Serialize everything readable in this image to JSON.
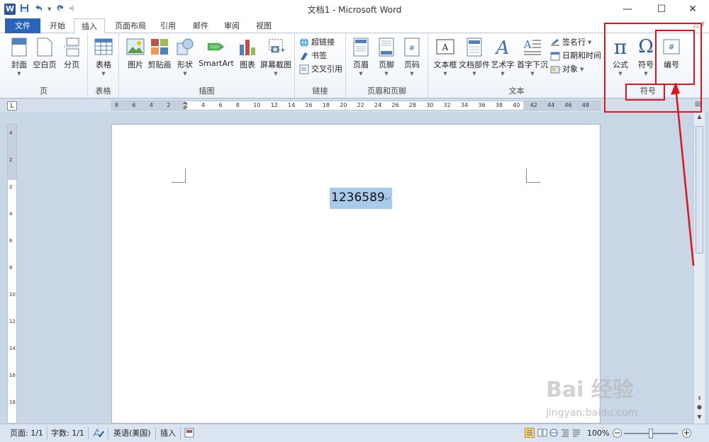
{
  "titlebar": {
    "app_icon_letter": "W",
    "title": "文档1 - Microsoft Word",
    "minimize": "—",
    "maximize": "☐",
    "close": "✕"
  },
  "tabs": {
    "file": "文件",
    "items": [
      "开始",
      "插入",
      "页面布局",
      "引用",
      "邮件",
      "审阅",
      "视图"
    ],
    "active": "插入"
  },
  "ribbon": {
    "page_group": {
      "label": "页",
      "buttons": [
        "封面",
        "空白页",
        "分页"
      ]
    },
    "table_group": {
      "label": "表格",
      "buttons": [
        "表格"
      ]
    },
    "illustrations_group": {
      "label": "插图",
      "buttons": [
        "图片",
        "剪贴画",
        "形状",
        "SmartArt",
        "图表",
        "屏幕截图"
      ]
    },
    "links_group": {
      "label": "链接",
      "buttons": [
        "超链接",
        "书签",
        "交叉引用"
      ]
    },
    "header_footer_group": {
      "label": "页眉和页脚",
      "buttons": [
        "页眉",
        "页脚",
        "页码"
      ]
    },
    "text_group": {
      "label": "文本",
      "buttons": [
        "文本框",
        "文档部件",
        "艺术字",
        "首字下沉"
      ],
      "small_buttons": [
        "签名行",
        "日期和时间",
        "对象"
      ]
    },
    "symbols_group": {
      "label": "符号",
      "buttons": [
        "公式",
        "符号",
        "编号"
      ]
    }
  },
  "ruler": {
    "numbers": [
      "8",
      "6",
      "4",
      "2",
      "2",
      "4",
      "6",
      "8",
      "10",
      "12",
      "14",
      "16",
      "18",
      "20",
      "22",
      "24",
      "26",
      "28",
      "30",
      "32",
      "34",
      "36",
      "38",
      "40",
      "42",
      "44",
      "46",
      "48"
    ],
    "vertical_numbers": [
      "4",
      "2",
      "2",
      "4",
      "6",
      "8",
      "10",
      "12",
      "14",
      "16",
      "18"
    ]
  },
  "document": {
    "selected_text": "1236589",
    "paragraph_mark": "↵"
  },
  "statusbar": {
    "page": "页面: 1/1",
    "words": "字数: 1/1",
    "language": "英语(美国)",
    "mode": "插入",
    "zoom": "100%"
  },
  "watermark": {
    "brand": "Bai 经验",
    "url": "jingyan.baidu.com"
  },
  "colors": {
    "file_tab": "#2a64b8",
    "annotation": "#e0141e",
    "selection": "#a8cbeb"
  }
}
